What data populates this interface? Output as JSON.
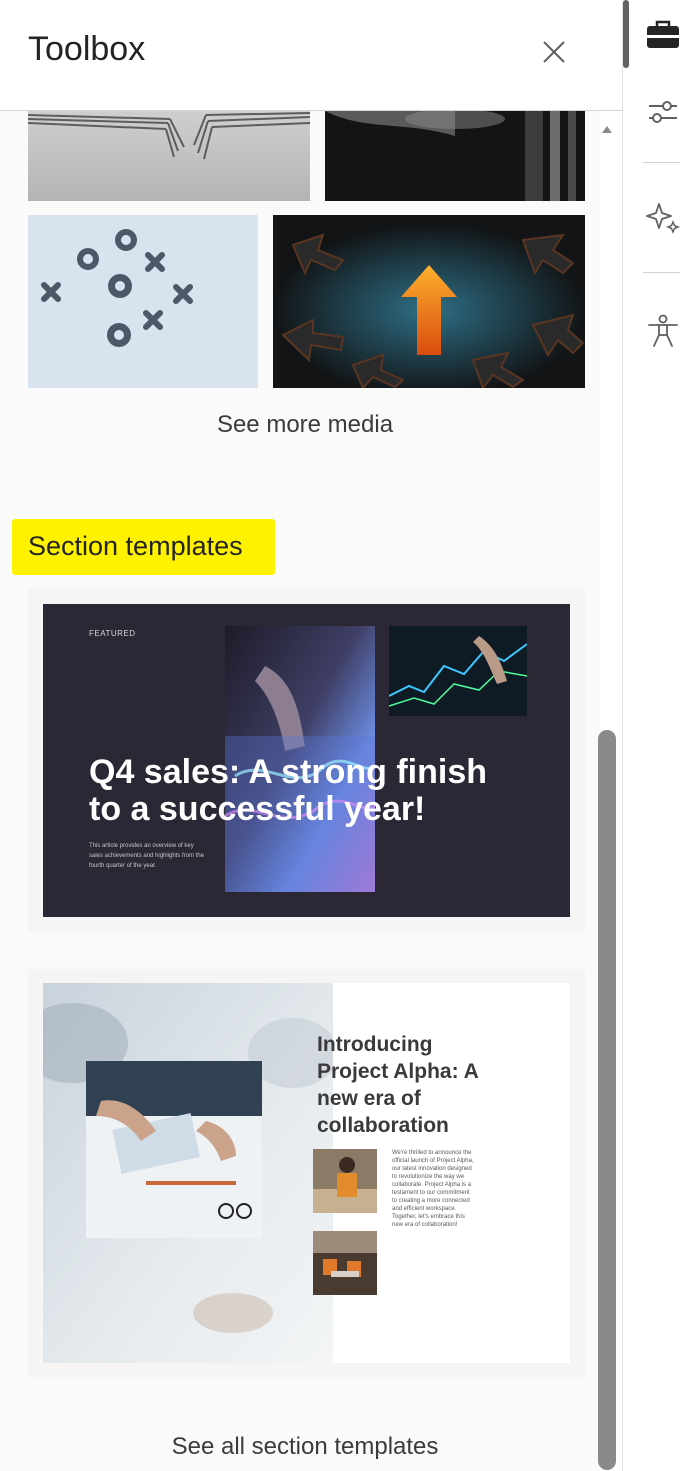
{
  "panel": {
    "title": "Toolbox",
    "close_icon": "close-icon"
  },
  "media": {
    "see_more_label": "See more media"
  },
  "section_templates": {
    "heading": "Section templates",
    "templates": [
      {
        "kicker": "FEATURED",
        "title": "Q4 sales: A strong finish to a successful year!",
        "description": "This article provides an overview of key sales achievements and highlights from the fourth quarter of the year."
      },
      {
        "title": "Introducing Project Alpha: A new era of collaboration",
        "description": "We're thrilled to announce the official launch of Project Alpha, our latest innovation designed to revolutionize the way we collaborate. Project Alpha is a testament to our commitment to creating a more connected and efficient workspace. Together, let's embrace this new era of collaboration!"
      }
    ],
    "see_all_label": "See all section templates"
  },
  "rail": {
    "items": [
      {
        "icon": "toolbox-briefcase-icon",
        "active": true
      },
      {
        "icon": "sliders-icon",
        "active": false
      },
      {
        "icon": "sparkle-icon",
        "active": false
      },
      {
        "icon": "accessibility-icon",
        "active": false
      }
    ]
  },
  "colors": {
    "highlight": "#fff200",
    "rail_active": "#616161",
    "scroll_thumb": "#8a8a8a"
  }
}
